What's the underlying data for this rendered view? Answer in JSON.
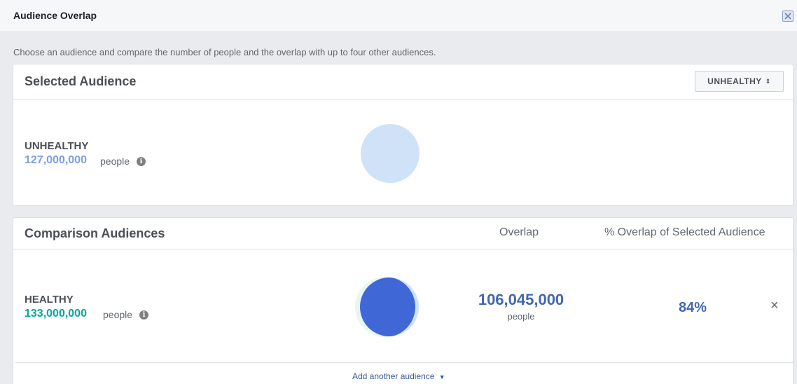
{
  "dialog": {
    "title": "Audience Overlap",
    "subtitle": "Choose an audience and compare the number of people and the overlap with up to four other audiences."
  },
  "selected": {
    "heading": "Selected Audience",
    "dropdown_value": "UNHEALTHY",
    "audience_name": "UNHEALTHY",
    "count": "127,000,000",
    "people_label": "people",
    "circle_color": "#cfe2f7"
  },
  "comparison": {
    "heading": "Comparison Audiences",
    "col_overlap": "Overlap",
    "col_pct": "% Overlap of Selected Audience",
    "rows": [
      {
        "name": "HEALTHY",
        "count": "133,000,000",
        "people_label": "people",
        "overlap": "106,045,000",
        "overlap_people_label": "people",
        "pct": "84%"
      }
    ],
    "add_label": "Add another audience"
  },
  "colors": {
    "selected_count": "#7b9ee5",
    "comparison_count": "#00a79d",
    "overlap_blue": "#4267b2",
    "venn_selected": "#cfe2f7",
    "venn_comparison": "#e7f6f2",
    "venn_intersection": "#3f67d6"
  }
}
